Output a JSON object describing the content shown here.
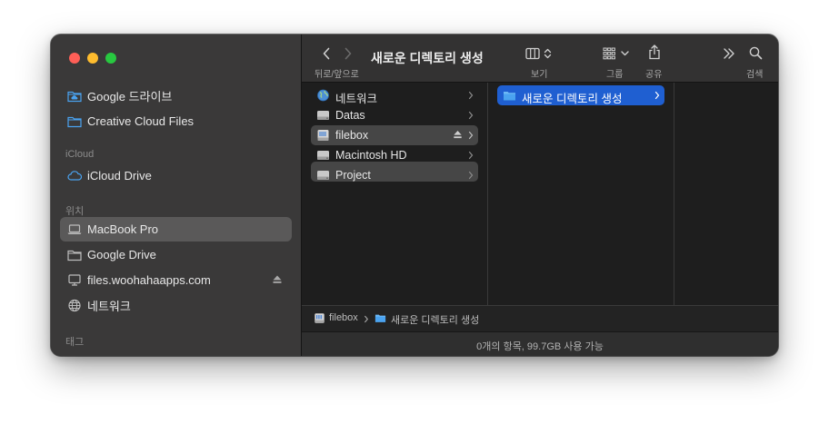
{
  "window": {
    "title": "새로운 디렉토리 생성"
  },
  "sidebar": {
    "top_items": [
      {
        "label": "Google 드라이브",
        "icon": "folder-cloud-icon"
      },
      {
        "label": "Creative Cloud Files",
        "icon": "folder-icon"
      }
    ],
    "icloud_header": "iCloud",
    "icloud_items": [
      {
        "label": "iCloud Drive",
        "icon": "cloud-icon"
      }
    ],
    "locations_header": "위치",
    "location_items": [
      {
        "label": "MacBook Pro",
        "icon": "laptop-icon",
        "selected": true
      },
      {
        "label": "Google Drive",
        "icon": "folder-icon"
      },
      {
        "label": "files.woohahaapps.com",
        "icon": "display-icon",
        "eject": true
      },
      {
        "label": "네트워크",
        "icon": "globe-icon"
      }
    ],
    "tags_header": "태그"
  },
  "toolbar": {
    "back_forward_label": "뒤로/앞으로",
    "view_label": "보기",
    "group_label": "그룹",
    "share_label": "공유",
    "search_label": "검색"
  },
  "columns": {
    "col1": [
      {
        "label": "네트워크",
        "icon": "network-globe-icon"
      },
      {
        "label": "Datas",
        "icon": "drive-icon"
      },
      {
        "label": "filebox",
        "icon": "nas-drive-icon",
        "selected": true,
        "eject": true
      },
      {
        "label": "Macintosh HD",
        "icon": "drive-icon"
      },
      {
        "label": "Project",
        "icon": "drive-icon"
      }
    ],
    "col2": [
      {
        "label": "새로운 디렉토리 생성",
        "icon": "folder-icon",
        "selected": true
      }
    ]
  },
  "pathbar": {
    "segment1": "filebox",
    "segment2": "새로운 디렉토리 생성"
  },
  "status": "0개의 항목, 99.7GB 사용 가능",
  "colors": {
    "accent": "#1f5fd1",
    "folder_blue": "#4aa3f0",
    "sidebar_bg": "#3a3939",
    "window_bg": "#1e1e1e"
  }
}
